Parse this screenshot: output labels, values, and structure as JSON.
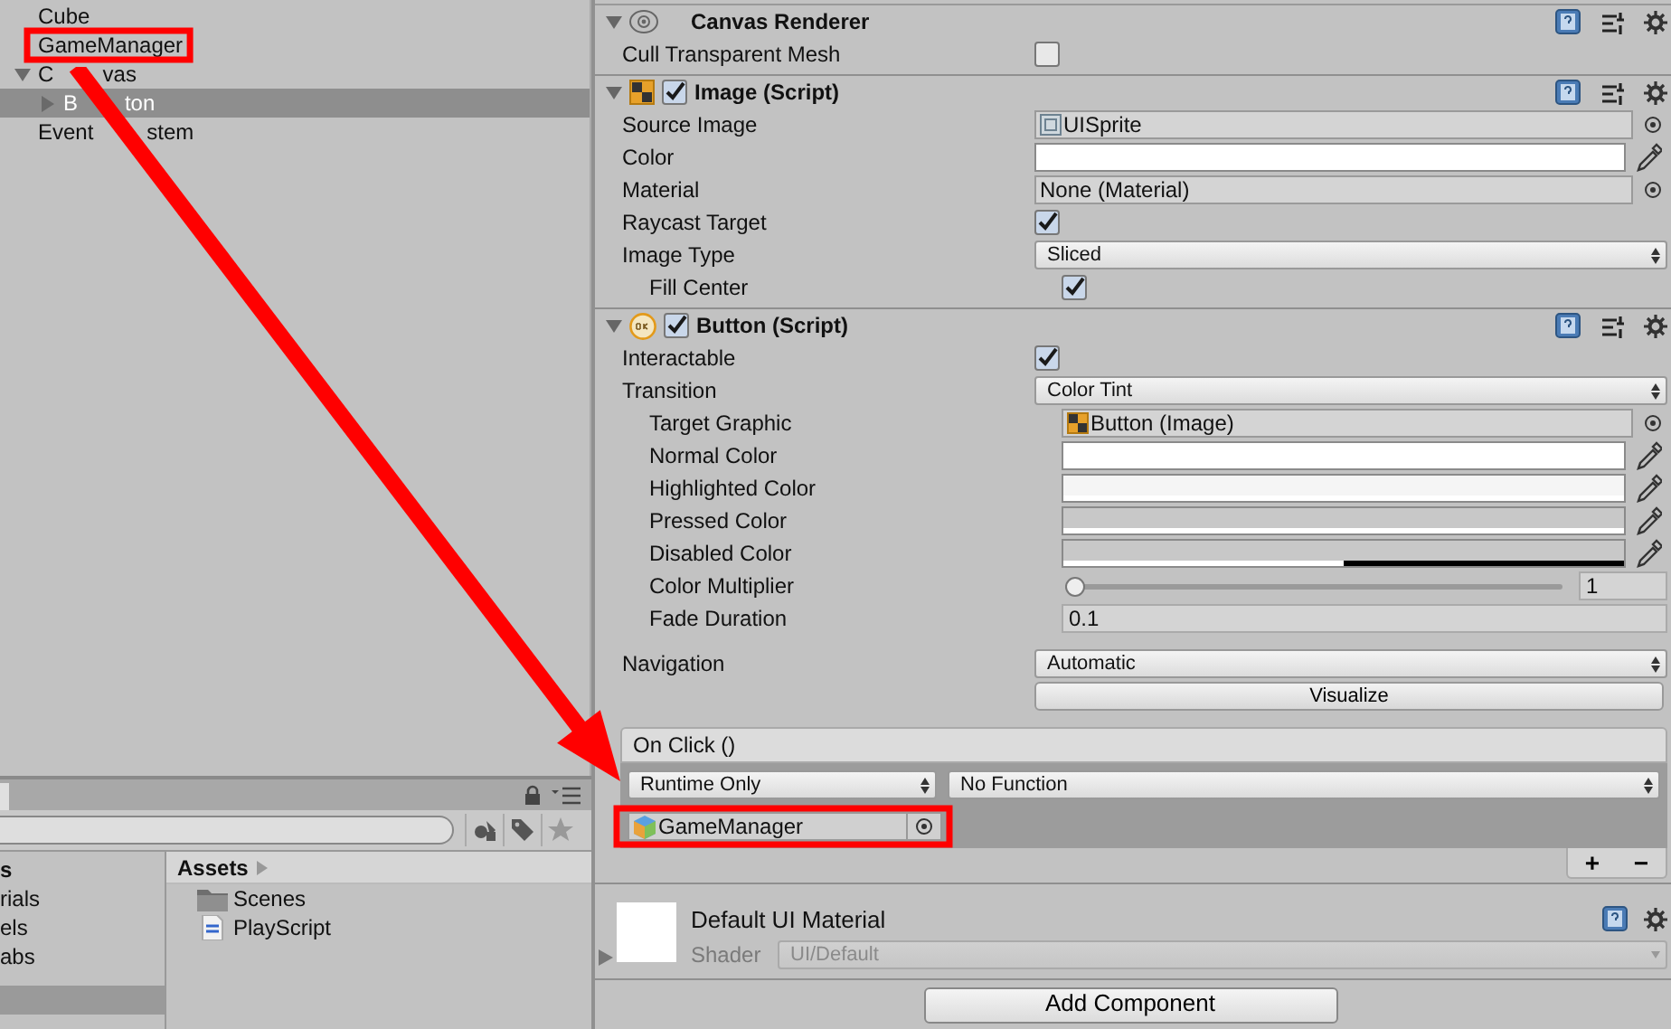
{
  "hierarchy": {
    "items": [
      {
        "label_parts": [
          "Cube"
        ],
        "selected": false,
        "highlighted": false
      },
      {
        "label_parts": [
          "GameManager"
        ],
        "selected": false,
        "highlighted": true
      },
      {
        "label_parts": [
          "C",
          "vas"
        ],
        "selected": false,
        "highlighted": false,
        "expanded": true,
        "children": [
          {
            "label_parts": [
              "B",
              "ton"
            ],
            "selected": true,
            "highlighted": false,
            "expanded": false
          }
        ]
      },
      {
        "label_parts": [
          "Event",
          "stem"
        ],
        "selected": false,
        "highlighted": false
      }
    ]
  },
  "project": {
    "folders": [
      {
        "label": "s",
        "kind": "heading",
        "selected": false
      },
      {
        "label": "rials",
        "kind": "folder",
        "selected": false
      },
      {
        "label": "els",
        "kind": "folder",
        "selected": false
      },
      {
        "label": "abs",
        "kind": "folder",
        "selected": false
      },
      {
        "kind": "folder",
        "selected": true
      }
    ],
    "breadcrumb": "Assets",
    "assets": [
      {
        "label": "Scenes",
        "kind": "folder"
      },
      {
        "label": "PlayScript",
        "kind": "script"
      }
    ]
  },
  "inspector": {
    "components": [
      {
        "name": "Canvas Renderer",
        "kind": "renderer",
        "expanded": true,
        "sections": [
          [
            {
              "label": "Cull Transparent Mesh",
              "kind": "checkbox",
              "checked": false
            }
          ]
        ]
      },
      {
        "name": "Image (Script)",
        "kind": "image-script",
        "enabled": true,
        "expanded": true,
        "sections": [
          [
            {
              "label": "Source Image",
              "kind": "sprite-ref",
              "value": "UISprite"
            },
            {
              "label": "Color",
              "kind": "color",
              "color": "#ffffff",
              "level": 1
            },
            {
              "label": "Material",
              "kind": "object",
              "value": "None (Material)"
            },
            {
              "label": "Raycast Target",
              "kind": "checkbox",
              "checked": true
            },
            {
              "label": "Image Type",
              "kind": "dropdown",
              "value": "Sliced",
              "children": [
                {
                  "label": "Fill Center",
                  "kind": "checkbox",
                  "checked": true
                }
              ]
            }
          ]
        ]
      },
      {
        "name": "Button (Script)",
        "kind": "button-script",
        "enabled": true,
        "expanded": true,
        "sections": [
          [
            {
              "label": "Interactable",
              "kind": "checkbox",
              "checked": true
            },
            {
              "label": "Transition",
              "kind": "dropdown",
              "value": "Color Tint",
              "children": [
                {
                  "label": "Target Graphic",
                  "kind": "image-ref",
                  "value": "Button (Image)"
                },
                {
                  "label": "Normal Color",
                  "kind": "color",
                  "color": "#ffffff",
                  "level": 1
                },
                {
                  "label": "Highlighted Color",
                  "kind": "color",
                  "color": "#f5f5f5",
                  "level": 1
                },
                {
                  "label": "Pressed Color",
                  "kind": "color",
                  "color": "#c8c8c8",
                  "level": 1
                },
                {
                  "label": "Disabled Color",
                  "kind": "color",
                  "color": "#c8c8c8",
                  "level": 0.5
                },
                {
                  "label": "Color Multiplier",
                  "kind": "slider",
                  "level": 0,
                  "value": "1"
                },
                {
                  "label": "Fade Duration",
                  "kind": "number",
                  "value": "0.1"
                }
              ]
            }
          ],
          [
            {
              "label": "Navigation",
              "kind": "dropdown",
              "value": "Automatic"
            },
            {
              "kind": "button",
              "value": "Visualize"
            }
          ]
        ],
        "on_click": {
          "title": "On Click ()",
          "entries": [
            {
              "mode": "Runtime Only",
              "function": "No Function",
              "target": "GameManager",
              "highlighted": true
            }
          ],
          "add": "+",
          "remove": "−"
        }
      }
    ],
    "material": {
      "name": "Default UI Material",
      "shader_label": "Shader",
      "shader": "UI/Default",
      "expanded": false
    },
    "add_component": "Add Component"
  }
}
